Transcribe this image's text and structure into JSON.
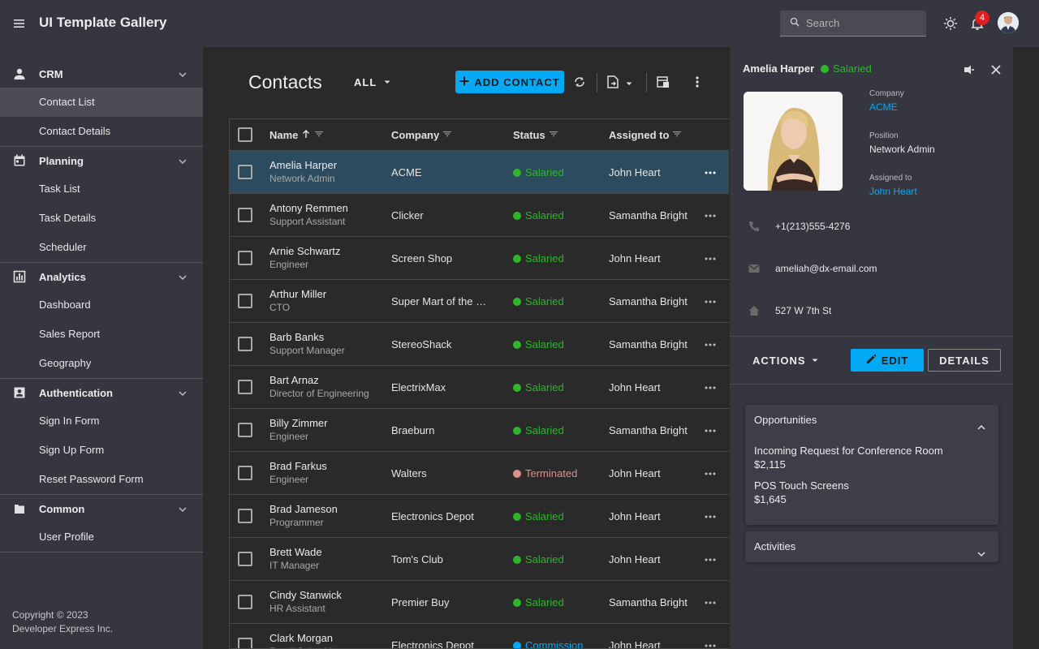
{
  "header": {
    "app_title": "UI Template Gallery",
    "search_placeholder": "Search",
    "notification_count": "4"
  },
  "sidebar": {
    "groups": [
      {
        "label": "CRM",
        "icon": "person-icon",
        "items": [
          "Contact List",
          "Contact Details"
        ]
      },
      {
        "label": "Planning",
        "icon": "calendar-icon",
        "items": [
          "Task List",
          "Task Details",
          "Scheduler"
        ]
      },
      {
        "label": "Analytics",
        "icon": "chart-icon",
        "items": [
          "Dashboard",
          "Sales Report",
          "Geography"
        ]
      },
      {
        "label": "Authentication",
        "icon": "id-badge-icon",
        "items": [
          "Sign In Form",
          "Sign Up Form",
          "Reset Password Form"
        ]
      },
      {
        "label": "Common",
        "icon": "folder-icon",
        "items": [
          "User Profile"
        ]
      }
    ],
    "active_item": "Contact List",
    "copyright_line1": "Copyright © 2023",
    "copyright_line2": "Developer Express Inc."
  },
  "main": {
    "title": "Contacts",
    "filter_label": "ALL",
    "add_button_label": "ADD CONTACT",
    "columns": [
      "Name",
      "Company",
      "Status",
      "Assigned to"
    ],
    "rows": [
      {
        "name": "Amelia Harper",
        "position": "Network Admin",
        "company": "ACME",
        "status": "Salaried",
        "assigned": "John Heart",
        "selected": true
      },
      {
        "name": "Antony Remmen",
        "position": "Support Assistant",
        "company": "Clicker",
        "status": "Salaried",
        "assigned": "Samantha Bright"
      },
      {
        "name": "Arnie Schwartz",
        "position": "Engineer",
        "company": "Screen Shop",
        "status": "Salaried",
        "assigned": "John Heart"
      },
      {
        "name": "Arthur Miller",
        "position": "CTO",
        "company": "Super Mart of the W…",
        "status": "Salaried",
        "assigned": "Samantha Bright"
      },
      {
        "name": "Barb Banks",
        "position": "Support Manager",
        "company": "StereoShack",
        "status": "Salaried",
        "assigned": "Samantha Bright"
      },
      {
        "name": "Bart Arnaz",
        "position": "Director of Engineering",
        "company": "ElectrixMax",
        "status": "Salaried",
        "assigned": "John Heart"
      },
      {
        "name": "Billy Zimmer",
        "position": "Engineer",
        "company": "Braeburn",
        "status": "Salaried",
        "assigned": "Samantha Bright"
      },
      {
        "name": "Brad Farkus",
        "position": "Engineer",
        "company": "Walters",
        "status": "Terminated",
        "assigned": "John Heart"
      },
      {
        "name": "Brad Jameson",
        "position": "Programmer",
        "company": "Electronics Depot",
        "status": "Salaried",
        "assigned": "John Heart"
      },
      {
        "name": "Brett Wade",
        "position": "IT Manager",
        "company": "Tom's Club",
        "status": "Salaried",
        "assigned": "John Heart"
      },
      {
        "name": "Cindy Stanwick",
        "position": "HR Assistant",
        "company": "Premier Buy",
        "status": "Salaried",
        "assigned": "Samantha Bright"
      },
      {
        "name": "Clark Morgan",
        "position": "Retail Sales Manager",
        "company": "Electronics Depot",
        "status": "Commission",
        "assigned": "John Heart"
      }
    ],
    "status_colors": {
      "Salaried": "#2eb52c",
      "Terminated": "#de8e8c",
      "Commission": "#03a9f4"
    }
  },
  "panel": {
    "name": "Amelia Harper",
    "status": "Salaried",
    "company_label": "Company",
    "company": "ACME",
    "position_label": "Position",
    "position": "Network Admin",
    "assigned_label": "Assigned to",
    "assigned": "John Heart",
    "phone": "+1(213)555-4276",
    "email": "ameliah@dx-email.com",
    "address": "527 W 7th St",
    "actions_label": "ACTIONS",
    "edit_label": "EDIT",
    "details_label": "DETAILS",
    "opportunities_title": "Opportunities",
    "opportunities": [
      {
        "title": "Incoming Request for Conference Room",
        "amount": "$2,115"
      },
      {
        "title": "POS Touch Screens",
        "amount": "$1,645"
      }
    ],
    "activities_title": "Activities"
  },
  "colors": {
    "accent": "#03a9f4",
    "background": "#2a2a2a",
    "surface": "#363640",
    "selected_row": "#2d4b5e"
  }
}
